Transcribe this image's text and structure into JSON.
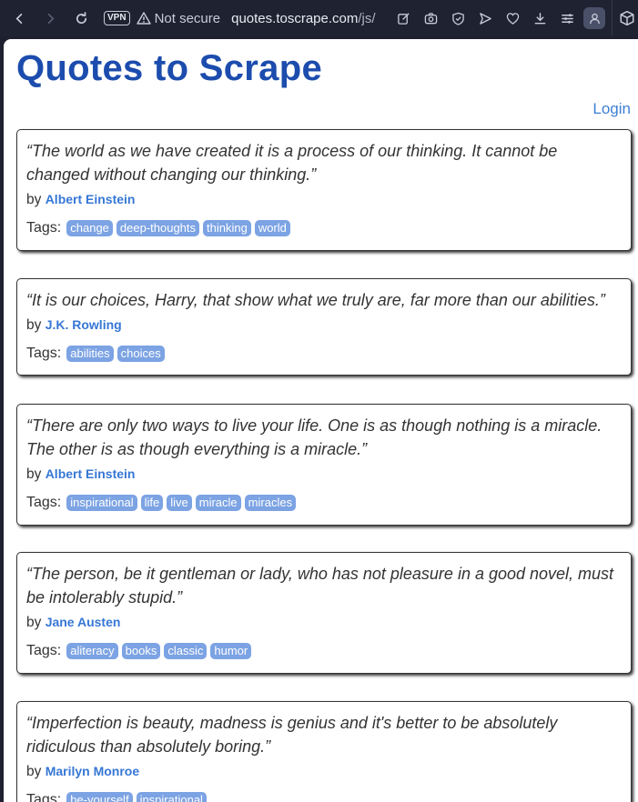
{
  "browser": {
    "vpn_label": "VPN",
    "security_label": "Not secure",
    "url_domain": "quotes.toscrape.com",
    "url_path": "/js/",
    "toolbar_icons": [
      "edit-icon",
      "camera-icon",
      "shield-icon",
      "send-icon",
      "heart-icon",
      "download-icon",
      "menu-icon",
      "profile-icon"
    ]
  },
  "page": {
    "title": "Quotes to Scrape",
    "login_label": "Login",
    "by_label": "by",
    "tags_label": "Tags:"
  },
  "quotes": [
    {
      "text": "“The world as we have created it is a process of our thinking. It cannot be changed without changing our thinking.”",
      "author": "Albert Einstein",
      "tags": [
        "change",
        "deep-thoughts",
        "thinking",
        "world"
      ]
    },
    {
      "text": "“It is our choices, Harry, that show what we truly are, far more than our abilities.”",
      "author": "J.K. Rowling",
      "tags": [
        "abilities",
        "choices"
      ]
    },
    {
      "text": "“There are only two ways to live your life. One is as though nothing is a miracle. The other is as though everything is a miracle.”",
      "author": "Albert Einstein",
      "tags": [
        "inspirational",
        "life",
        "live",
        "miracle",
        "miracles"
      ]
    },
    {
      "text": "“The person, be it gentleman or lady, who has not pleasure in a good novel, must be intolerably stupid.”",
      "author": "Jane Austen",
      "tags": [
        "aliteracy",
        "books",
        "classic",
        "humor"
      ]
    },
    {
      "text": "“Imperfection is beauty, madness is genius and it's better to be absolutely ridiculous than absolutely boring.”",
      "author": "Marilyn Monroe",
      "tags": [
        "be-yourself",
        "inspirational"
      ]
    }
  ],
  "colors": {
    "title": "#1c4cad",
    "author_link": "#3677d5",
    "tag_bg": "#7ca3e3",
    "chrome_bg": "#1f2231"
  }
}
